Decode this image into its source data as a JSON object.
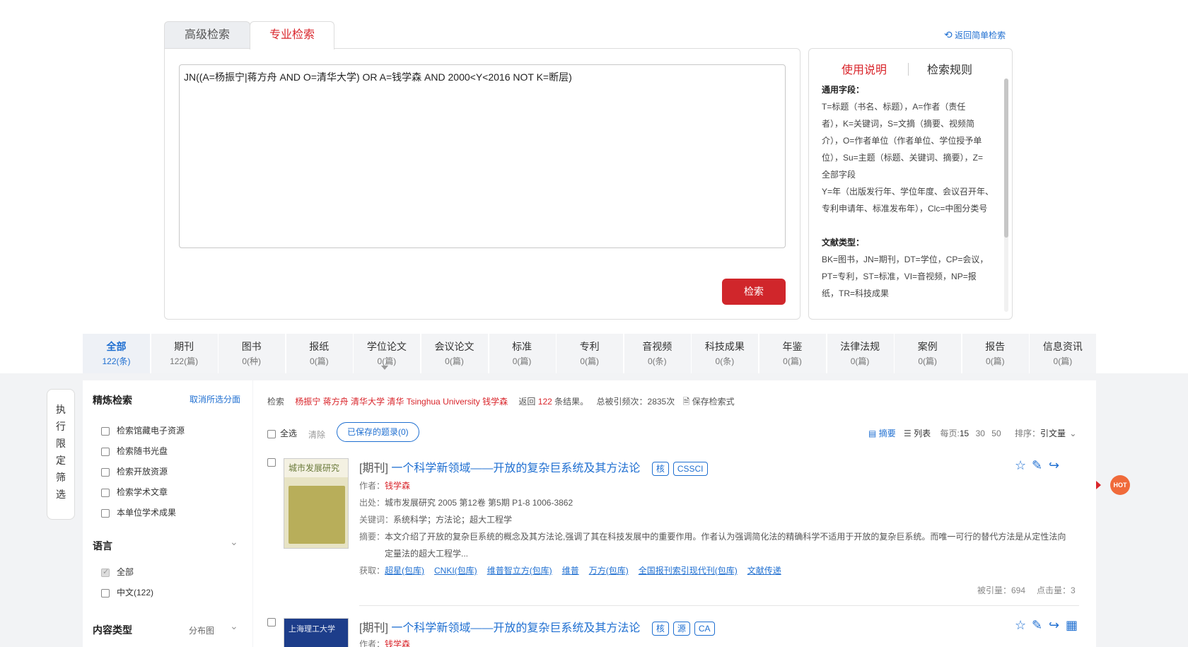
{
  "search_tabs": [
    {
      "label": "高级检索"
    },
    {
      "label": "专业检索"
    }
  ],
  "back_link": "返回简单检索",
  "query": "JN((A=杨振宁|蒋方舟 AND O=清华大学) OR A=钱学森 AND 2000<Y<2016 NOT K=断层)",
  "search_button": "检索",
  "help": {
    "tab_usage": "使用说明",
    "tab_rules": "检索规则",
    "lines": [
      {
        "text": "通用字段：",
        "bold": true
      },
      {
        "text": "T=标题（书名、标题），A=作者（责任"
      },
      {
        "text": "者），K=关键词，S=文摘（摘要、视频简"
      },
      {
        "text": "介），O=作者单位（作者单位、学位授予单"
      },
      {
        "text": "位），Su=主题（标题、关键词、摘要），Z="
      },
      {
        "text": "全部字段"
      },
      {
        "text": "Y=年（出版发行年、学位年度、会议召开年、"
      },
      {
        "text": "专利申请年、标准发布年），Clc=中图分类号"
      },
      {
        "text": ""
      },
      {
        "text": "文献类型：",
        "bold": true
      },
      {
        "text": "BK=图书，JN=期刊，DT=学位，CP=会议，"
      },
      {
        "text": "PT=专利，ST=标准，VI=音视频，NP=报"
      },
      {
        "text": "纸，TR=科技成果"
      }
    ]
  },
  "categories": [
    {
      "name": "全部",
      "count": "122(条)"
    },
    {
      "name": "期刊",
      "count": "122(篇)"
    },
    {
      "name": "图书",
      "count": "0(种)"
    },
    {
      "name": "报纸",
      "count": "0(篇)"
    },
    {
      "name": "学位论文",
      "count": "0(篇)"
    },
    {
      "name": "会议论文",
      "count": "0(篇)"
    },
    {
      "name": "标准",
      "count": "0(篇)"
    },
    {
      "name": "专利",
      "count": "0(篇)"
    },
    {
      "name": "音视频",
      "count": "0(条)"
    },
    {
      "name": "科技成果",
      "count": "0(条)"
    },
    {
      "name": "年鉴",
      "count": "0(篇)"
    },
    {
      "name": "法律法规",
      "count": "0(篇)"
    },
    {
      "name": "案例",
      "count": "0(篇)"
    },
    {
      "name": "报告",
      "count": "0(篇)"
    },
    {
      "name": "信息资讯",
      "count": "0(篇)"
    }
  ],
  "side_vertical": [
    "执",
    "行",
    "限",
    "定",
    "筛",
    "选"
  ],
  "refine": {
    "title": "精炼检索",
    "cancel": "取消所选分面",
    "options": [
      "检索馆藏电子资源",
      "检索随书光盘",
      "检索开放资源",
      "检索学术文章",
      "本单位学术成果"
    ],
    "lang_title": "语言",
    "lang_options": [
      "全部",
      "中文(122)"
    ],
    "content_title": "内容类型",
    "content_dist": "分布图"
  },
  "summary": {
    "prefix": "检索",
    "terms": "杨振宁 蒋方舟 清华大学 清华 Tsinghua University 钱学森",
    "ret1": "返回",
    "count": "122",
    "ret2": "条结果。",
    "cited": "总被引频次：2835次",
    "save": "保存检索式"
  },
  "toolbar": {
    "select_all": "全选",
    "clear": "清除",
    "saved": "已保存的题录(0)",
    "view_abstract": "摘要",
    "view_list": "列表",
    "per_page_label": "每页:",
    "per_page": [
      "15",
      "30",
      "50"
    ],
    "sort_label": "排序：",
    "sort_value": "引文量"
  },
  "results": [
    {
      "type": "[期刊]",
      "title": "一个科学新领域——开放的复杂巨系统及其方法论",
      "tags": [
        "核",
        "CSSCI"
      ],
      "author_label": "作者：",
      "author": "钱学森",
      "source_label": "出处：",
      "source": "城市发展研究 2005 第12卷 第5期 P1-8  1006-3862",
      "kw_label": "关键词：",
      "keywords": "系统科学；方法论；超大工程学",
      "abs_label": "摘要：",
      "abstract1": "本文介绍了开放的复杂巨系统的概念及其方法论,强调了其在科技发展中的重要作用。作者认为强调简化法的精确科学不适用于开放的复杂巨系统。而唯一可行的替代方法是从定性法向",
      "abstract2": "定量法的超大工程学...",
      "get_label": "获取：",
      "links": [
        "超星(包库)",
        "CNKI(包库)",
        "维普智立方(包库)",
        "维普",
        "万方(包库)",
        "全国报刊索引现代刊(包库)",
        "文献传递"
      ],
      "cited": "被引量：694",
      "clicks": "点击量：3",
      "cover_title": "城市发展研究"
    },
    {
      "type": "[期刊]",
      "title": "一个科学新领域——开放的复杂巨系统及其方法论",
      "tags": [
        "核",
        "源",
        "CA"
      ],
      "author_label": "作者：",
      "author": "钱学森",
      "cover_title": "上海理工大学"
    }
  ],
  "hot_label": "HOT",
  "colors": {
    "brand_red": "#d0262b",
    "link_blue": "#1f6fd1"
  }
}
